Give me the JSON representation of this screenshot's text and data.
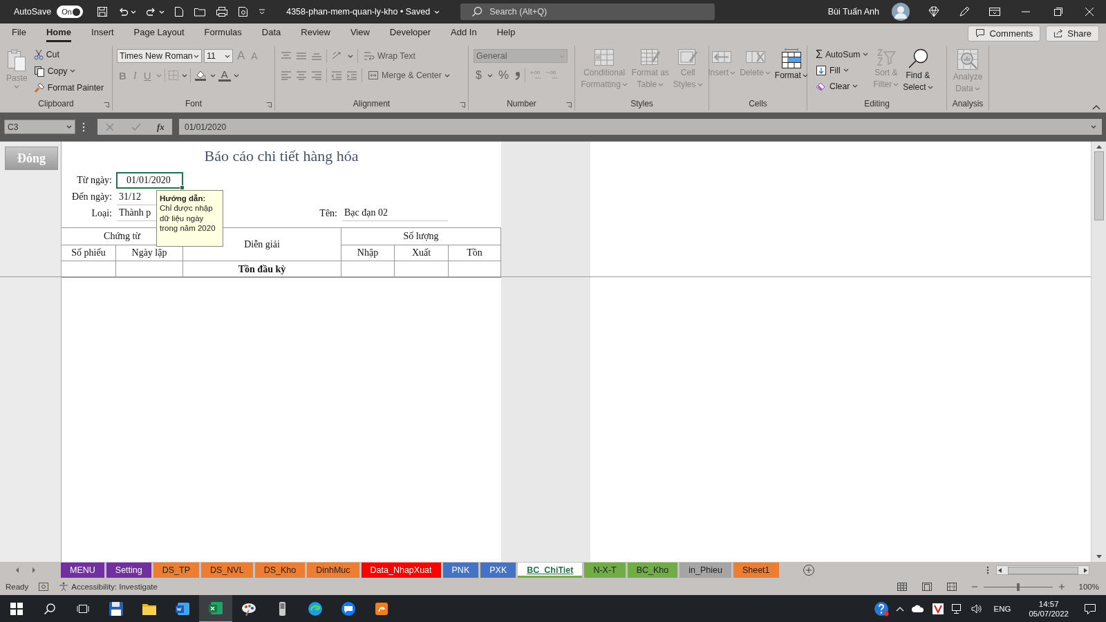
{
  "title_bar": {
    "autosave_label": "AutoSave",
    "autosave_state": "On",
    "autosave_on": true,
    "file_name": "4358-phan-mem-quan-ly-kho • Saved",
    "search_placeholder": "Search (Alt+Q)",
    "user_name": "Bùi Tuấn Anh"
  },
  "ribbon_tabs": [
    {
      "label": "File",
      "selected": false
    },
    {
      "label": "Home",
      "selected": true
    },
    {
      "label": "Insert",
      "selected": false
    },
    {
      "label": "Page Layout",
      "selected": false
    },
    {
      "label": "Formulas",
      "selected": false
    },
    {
      "label": "Data",
      "selected": false
    },
    {
      "label": "Review",
      "selected": false
    },
    {
      "label": "View",
      "selected": false
    },
    {
      "label": "Developer",
      "selected": false
    },
    {
      "label": "Add In",
      "selected": false
    },
    {
      "label": "Help",
      "selected": false
    }
  ],
  "comments_button": "Comments",
  "share_button": "Share",
  "clipboard": {
    "paste": "Paste",
    "cut": "Cut",
    "copy": "Copy",
    "format_painter": "Format Painter",
    "label": "Clipboard"
  },
  "font": {
    "family": "Times New Roman",
    "size": "11",
    "grow": "A",
    "shrink": "A",
    "bold": "B",
    "italic": "I",
    "underline": "U",
    "font_color": "A",
    "label": "Font"
  },
  "alignment": {
    "wrap_text": "Wrap Text",
    "merge_center": "Merge & Center",
    "label": "Alignment"
  },
  "number": {
    "format": "General",
    "format_disabled": true,
    "currency": "$",
    "percent": "%",
    "label": "Number"
  },
  "styles": {
    "buttons": [
      {
        "kind": "conditional",
        "lines": [
          "Conditional",
          "Formatting"
        ],
        "disabled": true
      },
      {
        "kind": "table",
        "lines": [
          "Format as",
          "Table"
        ],
        "disabled": true
      },
      {
        "kind": "cellstyles",
        "lines": [
          "Cell",
          "Styles"
        ],
        "disabled": true
      }
    ],
    "label": "Styles"
  },
  "cells": {
    "buttons": [
      {
        "kind": "insert",
        "lines": [
          "Insert"
        ],
        "disabled": true
      },
      {
        "kind": "delete",
        "lines": [
          "Delete"
        ],
        "disabled": true
      },
      {
        "kind": "format",
        "lines": [
          "Format"
        ],
        "disabled": false
      }
    ],
    "label": "Cells"
  },
  "editing": {
    "autosum_symbol": "Σ",
    "autosum": "AutoSum",
    "fill": "Fill",
    "clear": "Clear",
    "buttons": [
      {
        "kind": "sort",
        "lines": [
          "Sort &",
          "Filter"
        ],
        "disabled": true
      },
      {
        "kind": "find",
        "lines": [
          "Find &",
          "Select"
        ],
        "disabled": false
      }
    ],
    "label": "Editing"
  },
  "analysis": {
    "buttons": [
      {
        "kind": "analyze",
        "lines": [
          "Analyze",
          "Data"
        ],
        "disabled": true
      }
    ],
    "label": "Analysis"
  },
  "formula_bar": {
    "name_box": "C3",
    "function_symbol": "fx",
    "formula": "01/01/2020"
  },
  "report": {
    "close_button": "Đóng",
    "title": "Báo cáo chi tiết hàng hóa",
    "fields": [
      {
        "label": "Từ ngày:",
        "value": "01/01/2020",
        "selected": true
      },
      {
        "label": "Đến ngày:",
        "value": "31/12",
        "selected": false
      },
      {
        "label": "Loại:",
        "value": "Thành p",
        "selected": false
      }
    ],
    "name_field": {
      "label": "Tên:",
      "value": "Bạc đạn 02"
    },
    "table": {
      "document_header": "Chứng từ",
      "description_header": "Diễn giải",
      "quantity_header": "Số lượng",
      "columns": [
        "Số phiếu",
        "Ngày lập",
        "Nhập",
        "Xuất",
        "Tồn"
      ],
      "rows": [
        {
          "label": "Tồn đầu kỳ"
        }
      ]
    },
    "tooltip": {
      "title": "Hướng dẫn:",
      "text": "Chỉ được nhập\ndữ liệu ngày\ntrong năm 2020"
    }
  },
  "sheet_tabs": [
    {
      "label": "MENU",
      "color": "#7030a0",
      "selected": false
    },
    {
      "label": "Setting",
      "color": "#7030a0",
      "selected": false
    },
    {
      "label": "DS_TP",
      "color": "#ed7d31",
      "selected": false
    },
    {
      "label": "DS_NVL",
      "color": "#ed7d31",
      "selected": false
    },
    {
      "label": "DS_Kho",
      "color": "#ed7d31",
      "selected": false
    },
    {
      "label": "DinhMuc",
      "color": "#ed7d31",
      "selected": false
    },
    {
      "label": "Data_NhapXuat",
      "color": "#ff0000",
      "selected": false
    },
    {
      "label": "PNK",
      "color": "#4472c4",
      "selected": false
    },
    {
      "label": "PXK",
      "color": "#4472c4",
      "selected": false
    },
    {
      "label": "BC_ChiTiet",
      "color": "#70ad47",
      "selected": true
    },
    {
      "label": "N-X-T",
      "color": "#70ad47",
      "selected": false
    },
    {
      "label": "BC_Kho",
      "color": "#70ad47",
      "selected": false
    },
    {
      "label": "in_Phieu",
      "color": "#a5a5a5",
      "selected": false
    },
    {
      "label": "Sheet1",
      "color": "#ed7d31",
      "selected": false
    }
  ],
  "status_bar": {
    "ready": "Ready",
    "accessibility": "Accessibility: Investigate",
    "zoom_slider": {
      "level": 0.5
    },
    "zoom": "100%"
  },
  "taskbar": {
    "apps": [
      {
        "kind": "floppy",
        "active": false
      },
      {
        "kind": "folder",
        "active": false
      },
      {
        "kind": "word",
        "active": false
      },
      {
        "kind": "excel",
        "active": true
      },
      {
        "kind": "paint",
        "active": false
      },
      {
        "kind": "phone",
        "active": false
      },
      {
        "kind": "edge",
        "active": false
      },
      {
        "kind": "chat",
        "active": false
      },
      {
        "kind": "pdf",
        "active": false
      }
    ],
    "language": "ENG",
    "time": "14:57",
    "date": "05/07/2022"
  }
}
